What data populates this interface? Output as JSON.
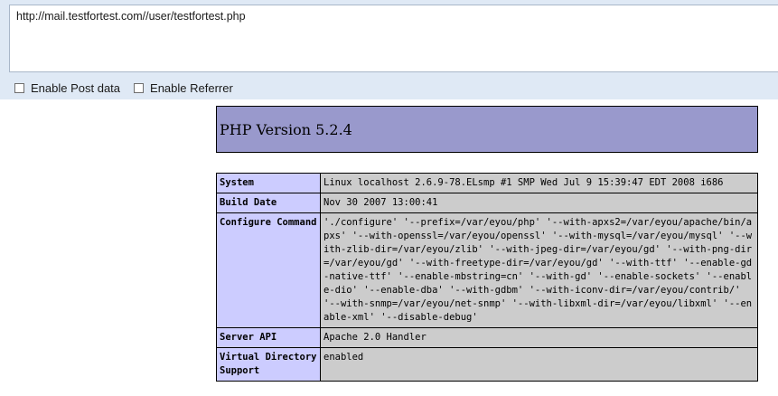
{
  "url": "http://mail.testfortest.com//user/testfortest.php",
  "options": [
    {
      "label": "Enable Post data"
    },
    {
      "label": "Enable Referrer"
    }
  ],
  "php_title": "PHP Version 5.2.4",
  "rows": [
    {
      "key": "System",
      "value": "Linux localhost 2.6.9-78.ELsmp #1 SMP Wed Jul 9 15:39:47 EDT 2008 i686"
    },
    {
      "key": "Build Date",
      "value": "Nov 30 2007 13:00:41"
    },
    {
      "key": "Configure Command",
      "value": "'./configure' '--prefix=/var/eyou/php' '--with-apxs2=/var/eyou/apache/bin/apxs' '--with-openssl=/var/eyou/openssl' '--with-mysql=/var/eyou/mysql' '--with-zlib-dir=/var/eyou/zlib' '--with-jpeg-dir=/var/eyou/gd' '--with-png-dir=/var/eyou/gd' '--with-freetype-dir=/var/eyou/gd' '--with-ttf' '--enable-gd-native-ttf' '--enable-mbstring=cn' '--with-gd' '--enable-sockets' '--enable-dio' '--enable-dba' '--with-gdbm' '--with-iconv-dir=/var/eyou/contrib/' '--with-snmp=/var/eyou/net-snmp' '--with-libxml-dir=/var/eyou/libxml' '--enable-xml' '--disable-debug'"
    },
    {
      "key": "Server API",
      "value": "Apache 2.0 Handler"
    },
    {
      "key": "Virtual Directory Support",
      "value": "enabled"
    }
  ]
}
